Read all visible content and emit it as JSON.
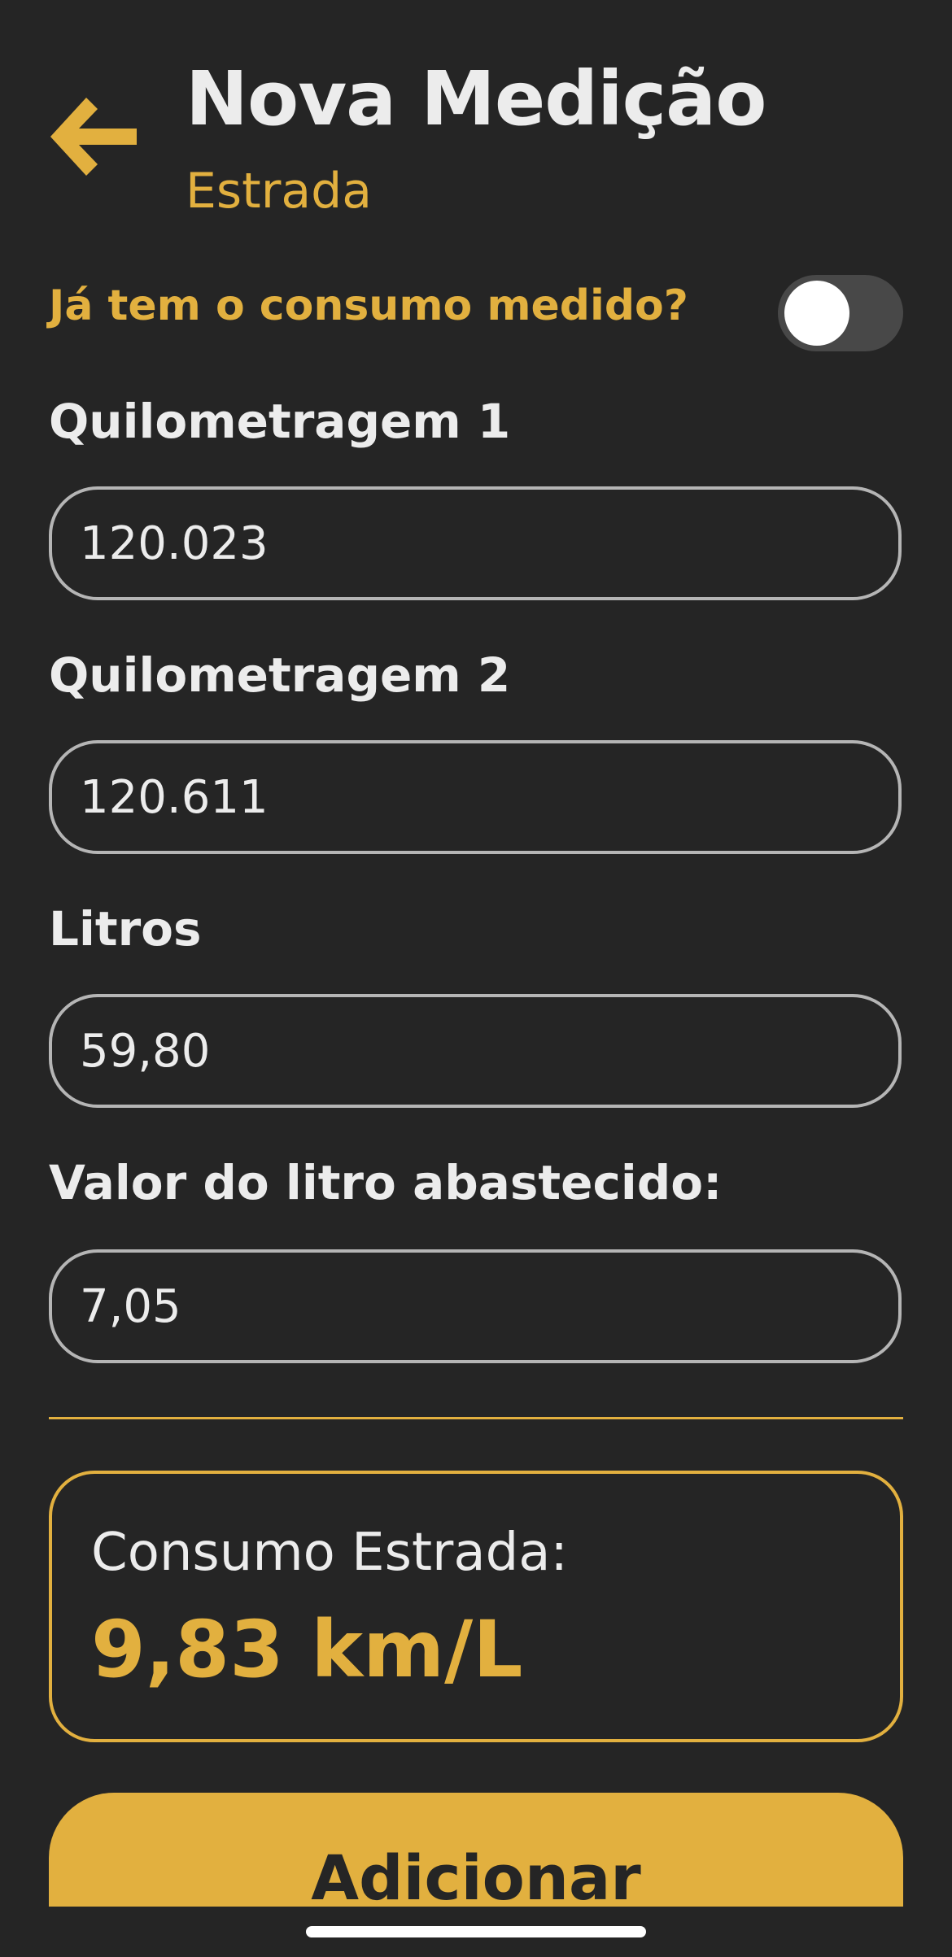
{
  "header": {
    "title": "Nova Medição",
    "subtitle": "Estrada",
    "back_icon": "arrow-left-icon"
  },
  "measured_toggle": {
    "question": "Já tem o consumo medido?",
    "state": "off"
  },
  "fields": [
    {
      "label": "Quilometragem 1",
      "value": "120.023"
    },
    {
      "label": "Quilometragem 2",
      "value": "120.611"
    },
    {
      "label": "Litros",
      "value": "59,80"
    },
    {
      "label": "Valor do litro abastecido:",
      "value": "7,05"
    }
  ],
  "result": {
    "label": "Consumo Estrada:",
    "value": "9,83 km/L"
  },
  "actions": {
    "add_label": "Adicionar"
  },
  "colors": {
    "background": "#252525",
    "accent": "#e2b03f",
    "text": "#ececec",
    "input_border": "#b5b5b5"
  }
}
